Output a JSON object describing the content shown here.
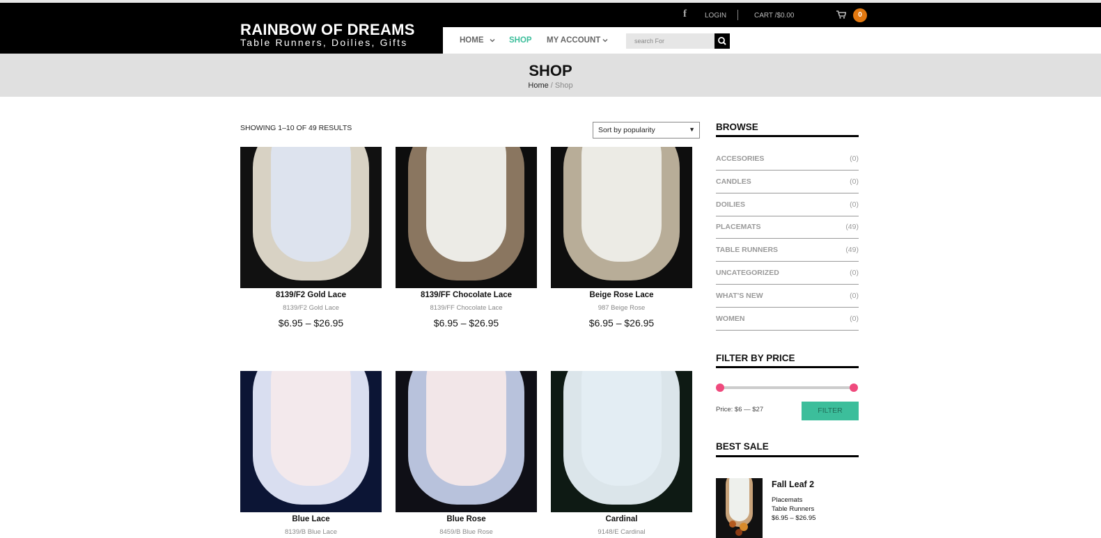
{
  "header": {
    "logo_title": "RAINBOW OF DREAMS",
    "logo_subtitle": "Table Runners, Doilies, Gifts",
    "login": "LOGIN",
    "cart": "CART /$0.00",
    "cart_count": "0"
  },
  "nav": {
    "items": [
      {
        "label": "HOME",
        "dropdown": true
      },
      {
        "label": "SHOP",
        "active": true
      },
      {
        "label": "MY ACCOUNT",
        "dropdown": true
      }
    ],
    "search_placeholder": "search For"
  },
  "page": {
    "title": "SHOP",
    "breadcrumb_home": "Home",
    "breadcrumb_sep": " / ",
    "breadcrumb_current": "Shop"
  },
  "toolbar": {
    "result_count": "SHOWING 1–10 OF 49 RESULTS",
    "sort_selected": "Sort by popularity"
  },
  "products": [
    {
      "name": "8139/F2 Gold Lace",
      "sku": "8139/F2 Gold Lace",
      "price": "$6.95 – $26.95",
      "bg": "#111111",
      "center": "#dde3ee",
      "lace": "#d8d2c4"
    },
    {
      "name": "8139/FF Chocolate Lace",
      "sku": "8139/FF Chocolate Lace",
      "price": "$6.95 – $26.95",
      "bg": "#0d0d0d",
      "center": "#ecebe6",
      "lace": "#8a7660"
    },
    {
      "name": "Beige Rose Lace",
      "sku": "987 Beige Rose",
      "price": "$6.95 – $26.95",
      "bg": "#0e0e0e",
      "center": "#ecebe5",
      "lace": "#b8ad98"
    },
    {
      "name": "Blue Lace",
      "sku": "8139/B Blue Lace",
      "price": "",
      "bg": "#0c1535",
      "center": "#f3e9ec",
      "lace": "#d9def0"
    },
    {
      "name": "Blue Rose",
      "sku": "8459/B Blue Rose",
      "price": "",
      "bg": "#0f0f16",
      "center": "#f2e6e8",
      "lace": "#b8c2dc"
    },
    {
      "name": "Cardinal",
      "sku": "9148/E Cardinal",
      "price": "",
      "bg": "#0e1a14",
      "center": "#e3edf3",
      "lace": "#dbe5ea"
    }
  ],
  "sidebar": {
    "browse_title": "BROWSE",
    "categories": [
      {
        "name": "ACCESORIES",
        "count": "(0)"
      },
      {
        "name": "CANDLES",
        "count": "(0)"
      },
      {
        "name": "DOILIES",
        "count": "(0)"
      },
      {
        "name": "PLACEMATS",
        "count": "(49)"
      },
      {
        "name": "TABLE RUNNERS",
        "count": "(49)"
      },
      {
        "name": "UNCATEGORIZED",
        "count": "(0)"
      },
      {
        "name": "WHAT'S NEW",
        "count": "(0)"
      },
      {
        "name": "WOMEN",
        "count": "(0)"
      }
    ],
    "filter_title": "FILTER BY PRICE",
    "price_min": 6,
    "price_max": 27,
    "price_range_text": "Price: $6 — $27",
    "filter_button": "FILTER",
    "best_sale_title": "BEST SALE",
    "best_sale": {
      "name": "Fall Leaf 2",
      "categories": [
        "Placemats",
        "Table Runners"
      ],
      "price": "$6.95 – $26.95"
    }
  },
  "colors": {
    "accent": "#3cbe9b",
    "cart_badge": "#e2780f",
    "slider_handle": "#ef4a7d"
  }
}
